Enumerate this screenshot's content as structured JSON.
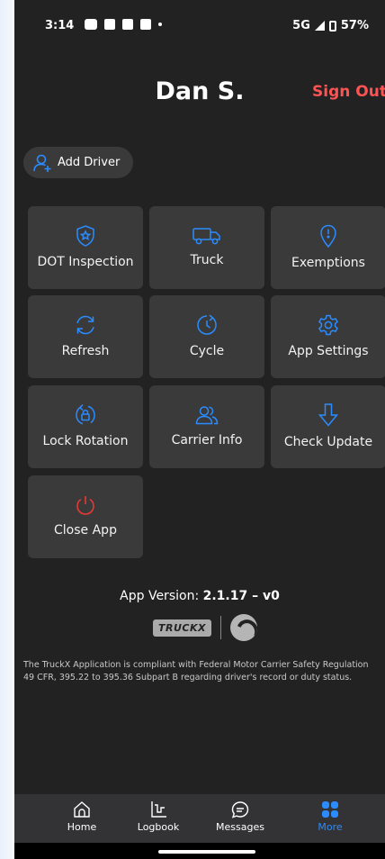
{
  "status_bar": {
    "time": "3:14",
    "network": "5G",
    "battery": "57%"
  },
  "header": {
    "user_name": "Dan S.",
    "sign_out": "Sign Out"
  },
  "add_driver": {
    "label": "Add Driver"
  },
  "tiles": [
    {
      "label": "DOT Inspection",
      "icon": "shield-star-icon",
      "color": "#2a8cff"
    },
    {
      "label": "Truck",
      "icon": "truck-icon",
      "color": "#2a8cff"
    },
    {
      "label": "Exemptions",
      "icon": "location-alert-icon",
      "color": "#2a8cff"
    },
    {
      "label": "Refresh",
      "icon": "refresh-icon",
      "color": "#2a8cff"
    },
    {
      "label": "Cycle",
      "icon": "clock-cycle-icon",
      "color": "#2a8cff"
    },
    {
      "label": "App Settings",
      "icon": "gear-icon",
      "color": "#2a8cff"
    },
    {
      "label": "Lock Rotation",
      "icon": "lock-rotation-icon",
      "color": "#2a8cff"
    },
    {
      "label": "Carrier Info",
      "icon": "people-icon",
      "color": "#2a8cff"
    },
    {
      "label": "Check Update",
      "icon": "arrow-down-icon",
      "color": "#2a8cff"
    },
    {
      "label": "Close App",
      "icon": "power-icon",
      "color": "#e53935"
    }
  ],
  "version": {
    "prefix": "App Version: ",
    "number": "2.1.17 – v0"
  },
  "logos": {
    "truckx": "TRUCKX"
  },
  "compliance_text": "The TruckX Application is compliant with Federal Motor Carrier Safety Regulation 49 CFR, 395.22 to 395.36 Subpart B regarding driver's record or duty status.",
  "bottom_nav": [
    {
      "label": "Home",
      "icon": "home-icon",
      "active": false
    },
    {
      "label": "Logbook",
      "icon": "logbook-icon",
      "active": false
    },
    {
      "label": "Messages",
      "icon": "messages-icon",
      "active": false
    },
    {
      "label": "More",
      "icon": "grid-icon",
      "active": true
    }
  ],
  "colors": {
    "background": "#222223",
    "tile": "#3a3a3b",
    "accent": "#2a8cff",
    "sign_out": "#ff5252",
    "close": "#e53935"
  }
}
